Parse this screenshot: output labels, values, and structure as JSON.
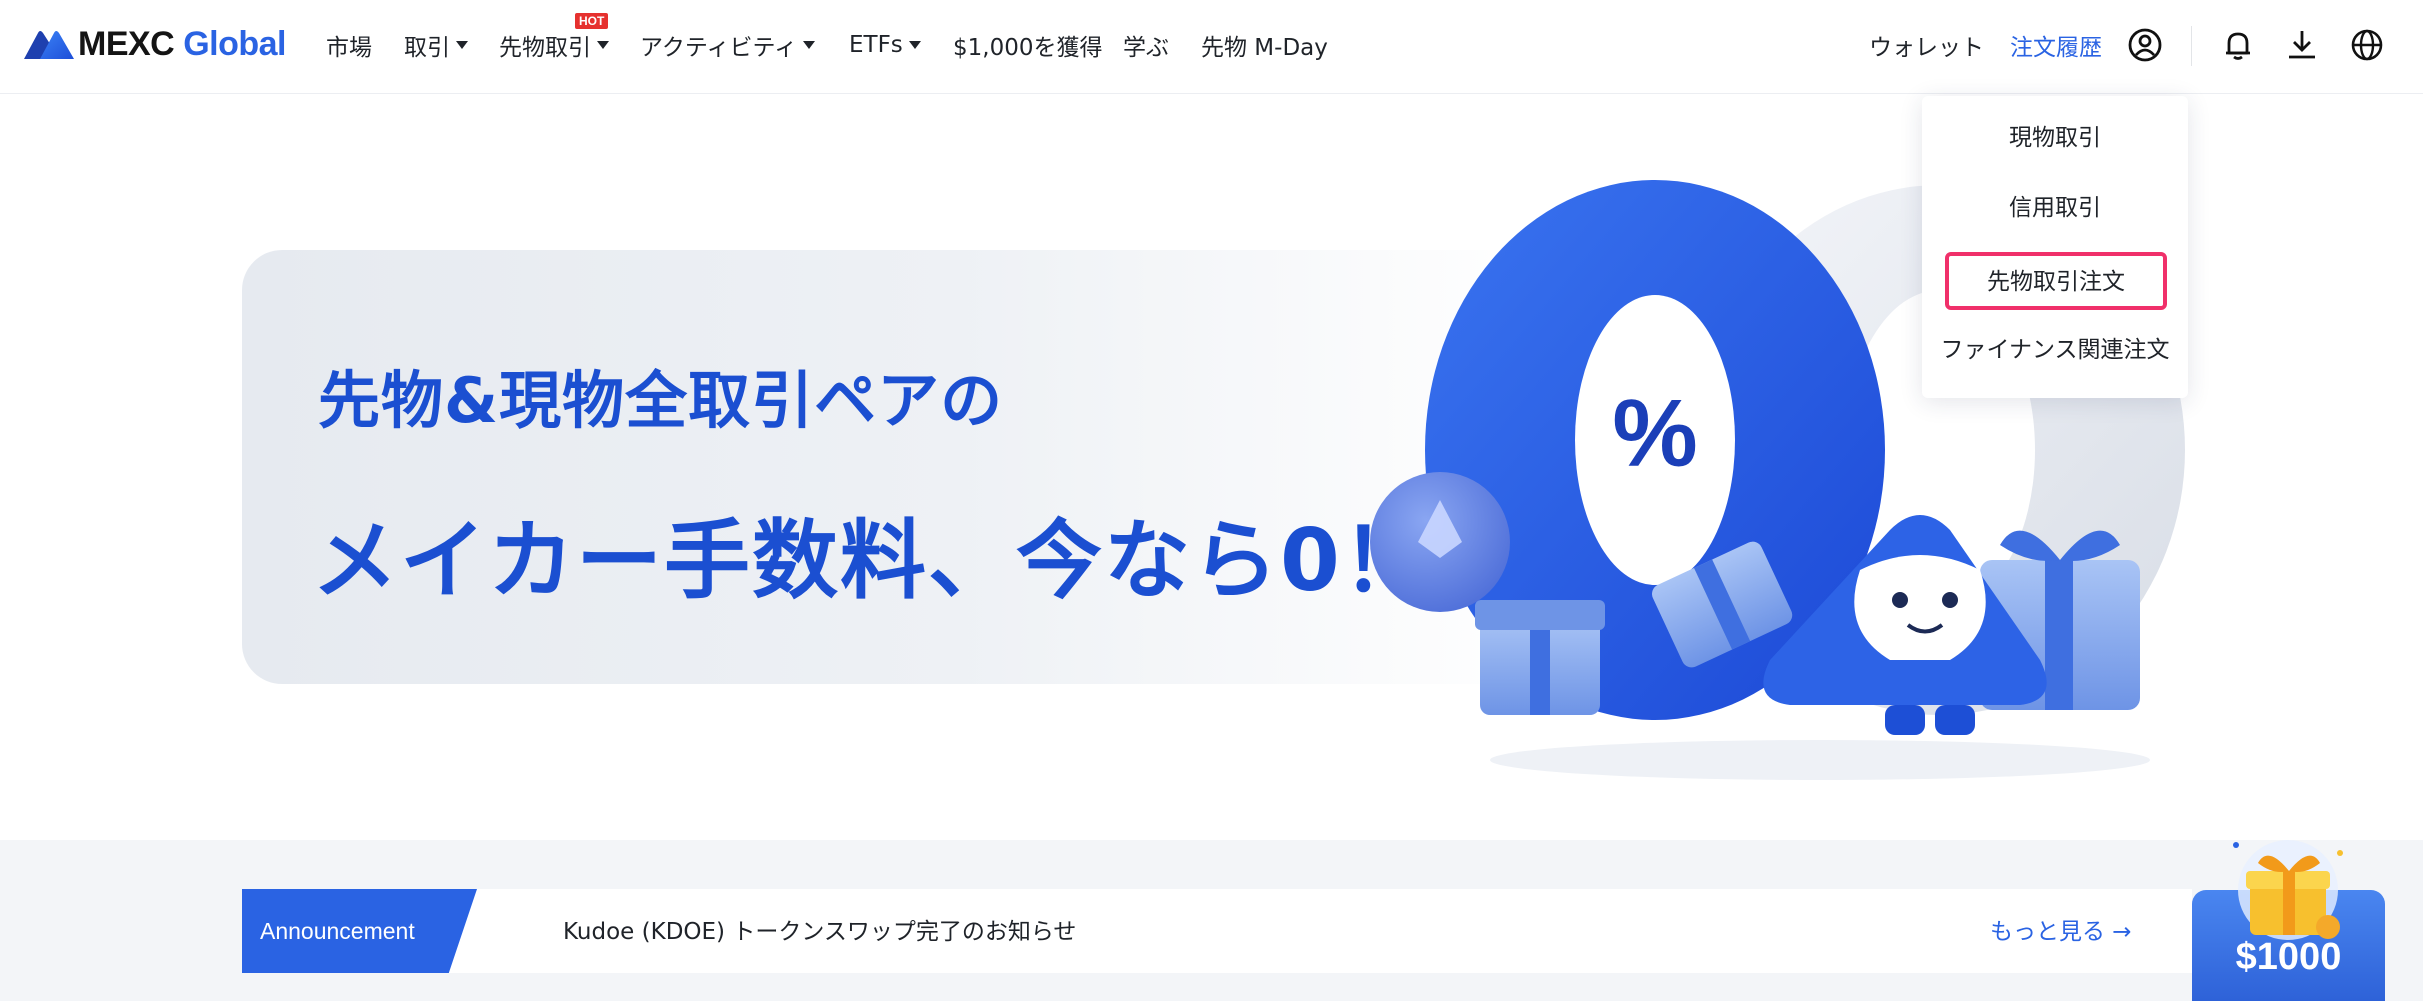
{
  "header": {
    "logo": {
      "brand": "MEXC",
      "suffix": "Global"
    },
    "nav": [
      {
        "label": "市場",
        "caret": false
      },
      {
        "label": "取引",
        "caret": true
      },
      {
        "label": "先物取引",
        "caret": true,
        "badge": "HOT"
      },
      {
        "label": "アクティビティ",
        "caret": true
      },
      {
        "label": "ETFs",
        "caret": true
      },
      {
        "label": "$1,000を獲得",
        "caret": false
      },
      {
        "label": "学ぶ",
        "caret": false
      },
      {
        "label": "先物 M-Day",
        "caret": false
      }
    ],
    "wallet_label": "ウォレット",
    "orders_label": "注文履歴",
    "icons": [
      "user-icon",
      "bell-icon",
      "download-icon",
      "globe-icon"
    ]
  },
  "orders_dropdown": {
    "items": [
      "現物取引",
      "信用取引",
      "先物取引注文",
      "ファイナンス関連注文"
    ],
    "highlighted_index": 2
  },
  "banner": {
    "line1": "先物&現物全取引ペアの",
    "line2": "メイカー手数料、今なら0！",
    "art_percent": "%"
  },
  "announcement": {
    "label": "Announcement",
    "text": "Kudoe (KDOE) トークンスワップ完了のお知らせ",
    "more": "もっと見る →"
  },
  "promo": {
    "amount": "$1000"
  },
  "colors": {
    "brand_blue": "#2a63e3",
    "banner_text": "#1b4fd1",
    "highlight": "#f0306a",
    "hot": "#e6312f"
  }
}
